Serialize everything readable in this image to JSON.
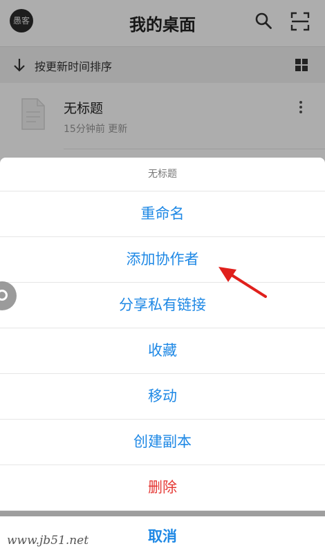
{
  "header": {
    "avatar_text": "愚客",
    "title": "我的桌面",
    "icons": [
      "search-icon",
      "scan-icon"
    ]
  },
  "sortbar": {
    "label": "按更新时间排序",
    "icons": [
      "arrow-down-icon",
      "grid-view-icon"
    ]
  },
  "document": {
    "name": "无标题",
    "meta": "15分钟前  更新"
  },
  "action_sheet": {
    "title": "无标题",
    "options": [
      {
        "label": "重命名"
      },
      {
        "label": "添加协作者"
      },
      {
        "label": "分享私有链接"
      },
      {
        "label": "收藏"
      },
      {
        "label": "移动"
      },
      {
        "label": "创建副本"
      },
      {
        "label": "删除"
      }
    ],
    "cancel": "取消"
  },
  "watermark": "www.jb51.net",
  "colors": {
    "accent": "#1e88e5",
    "danger": "#e53935",
    "annotation": "#e0201c"
  }
}
